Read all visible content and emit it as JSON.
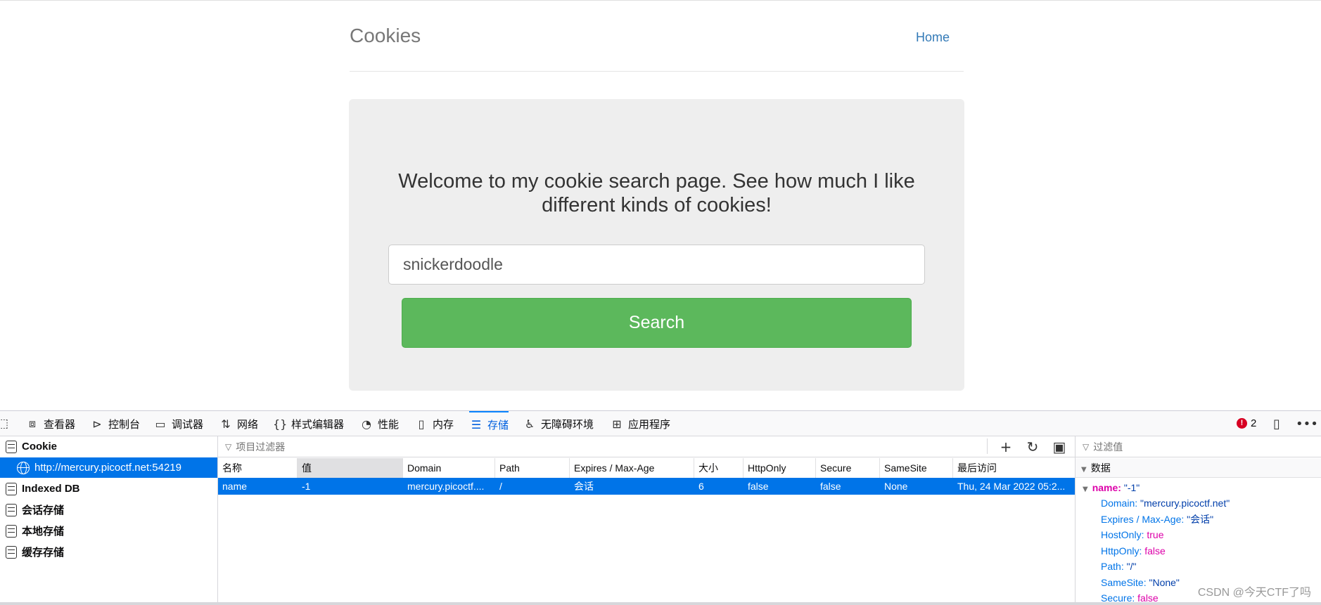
{
  "site": {
    "title": "Cookies",
    "home_link": "Home",
    "welcome": "Welcome to my cookie search page. See how much I like different kinds of cookies!",
    "search_value": "snickerdoodle",
    "search_button": "Search"
  },
  "devtools": {
    "tabs": [
      {
        "label": "查看器",
        "icon": "inspector-icon"
      },
      {
        "label": "控制台",
        "icon": "console-icon"
      },
      {
        "label": "调试器",
        "icon": "debugger-icon"
      },
      {
        "label": "网络",
        "icon": "network-icon"
      },
      {
        "label": "样式编辑器",
        "icon": "style-editor-icon"
      },
      {
        "label": "性能",
        "icon": "performance-icon"
      },
      {
        "label": "内存",
        "icon": "memory-icon"
      },
      {
        "label": "存储",
        "icon": "storage-icon"
      },
      {
        "label": "无障碍环境",
        "icon": "accessibility-icon"
      },
      {
        "label": "应用程序",
        "icon": "application-icon"
      }
    ],
    "active_tab": "存储",
    "error_count": "2",
    "sidebar": {
      "cookie": "Cookie",
      "origin": "http://mercury.picoctf.net:54219",
      "indexed_db": "Indexed DB",
      "session_storage": "会话存储",
      "local_storage": "本地存储",
      "cache_storage": "缓存存储"
    },
    "table": {
      "filter_placeholder": "项目过滤器",
      "columns": [
        "名称",
        "值",
        "Domain",
        "Path",
        "Expires / Max-Age",
        "大小",
        "HttpOnly",
        "Secure",
        "SameSite",
        "最后访问"
      ],
      "row": [
        "name",
        "-1",
        "mercury.picoctf....",
        "/",
        "会话",
        "6",
        "false",
        "false",
        "None",
        "Thu, 24 Mar 2022 05:2..."
      ]
    },
    "details": {
      "filter_placeholder": "过滤值",
      "section": "数据",
      "main_key": "name",
      "main_value": "\"-1\"",
      "props": [
        {
          "key": "Domain",
          "value": "\"mercury.picoctf.net\"",
          "kind": "str"
        },
        {
          "key": "Expires / Max-Age",
          "value": "\"会话\"",
          "kind": "str"
        },
        {
          "key": "HostOnly",
          "value": "true",
          "kind": "kw"
        },
        {
          "key": "HttpOnly",
          "value": "false",
          "kind": "kw"
        },
        {
          "key": "Path",
          "value": "\"/\"",
          "kind": "str"
        },
        {
          "key": "SameSite",
          "value": "\"None\"",
          "kind": "str"
        },
        {
          "key": "Secure",
          "value": "false",
          "kind": "kw"
        }
      ]
    }
  },
  "watermark": "CSDN @今天CTF了吗"
}
